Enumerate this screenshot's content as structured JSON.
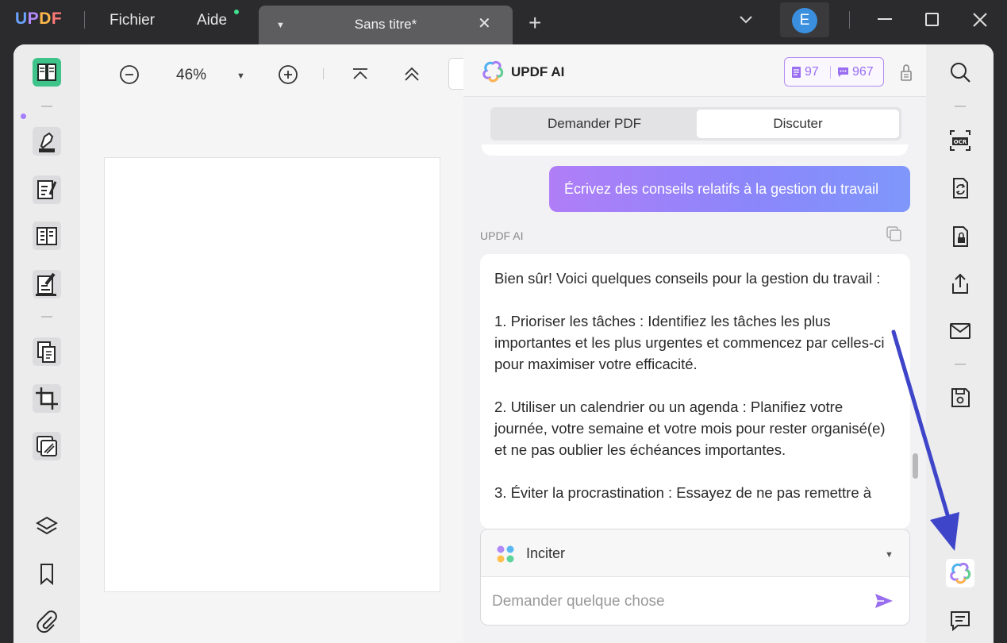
{
  "titlebar": {
    "logo": {
      "u": "U",
      "p": "P",
      "d": "D",
      "f": "F"
    },
    "menu_file": "Fichier",
    "menu_help": "Aide",
    "tab_title": "Sans titre*",
    "avatar_letter": "E"
  },
  "viewer": {
    "zoom": "46%"
  },
  "ai": {
    "title": "UPDF AI",
    "quota_doc": "97",
    "quota_chat": "967",
    "seg_ask_pdf": "Demander PDF",
    "seg_chat": "Discuter",
    "user_message": "Écrivez des conseils relatifs à la gestion du travail",
    "sender_label": "UPDF AI",
    "answer_text": "Bien sûr! Voici quelques conseils pour la gestion du travail :\n\n1. Prioriser les tâches : Identifiez les tâches les plus importantes et les plus urgentes et commencez par celles-ci pour maximiser votre efficacité.\n\n2. Utiliser un calendrier ou un agenda : Planifiez votre journée, votre semaine et votre mois pour rester organisé(e) et ne pas oublier les échéances importantes.\n\n3. Éviter la procrastination : Essayez de ne pas remettre à",
    "prompt_label": "Inciter",
    "input_placeholder": "Demander quelque chose"
  },
  "icons": {
    "left": [
      "reader-icon",
      "highlighter-icon",
      "edit-text-icon",
      "form-icon",
      "sign-icon",
      "organize-pages-icon",
      "crop-icon",
      "watermark-icon",
      "layers-icon",
      "bookmark-icon",
      "attachment-icon"
    ],
    "right": [
      "search-icon",
      "ocr-icon",
      "convert-icon",
      "protect-icon",
      "share-icon",
      "mail-icon",
      "save-icon",
      "updf-ai-icon",
      "comment-icon"
    ]
  },
  "colors": {
    "accent_purple": "#9a6ef0",
    "reader_green": "#3ec38a",
    "annotation_arrow": "#3f45c9"
  }
}
